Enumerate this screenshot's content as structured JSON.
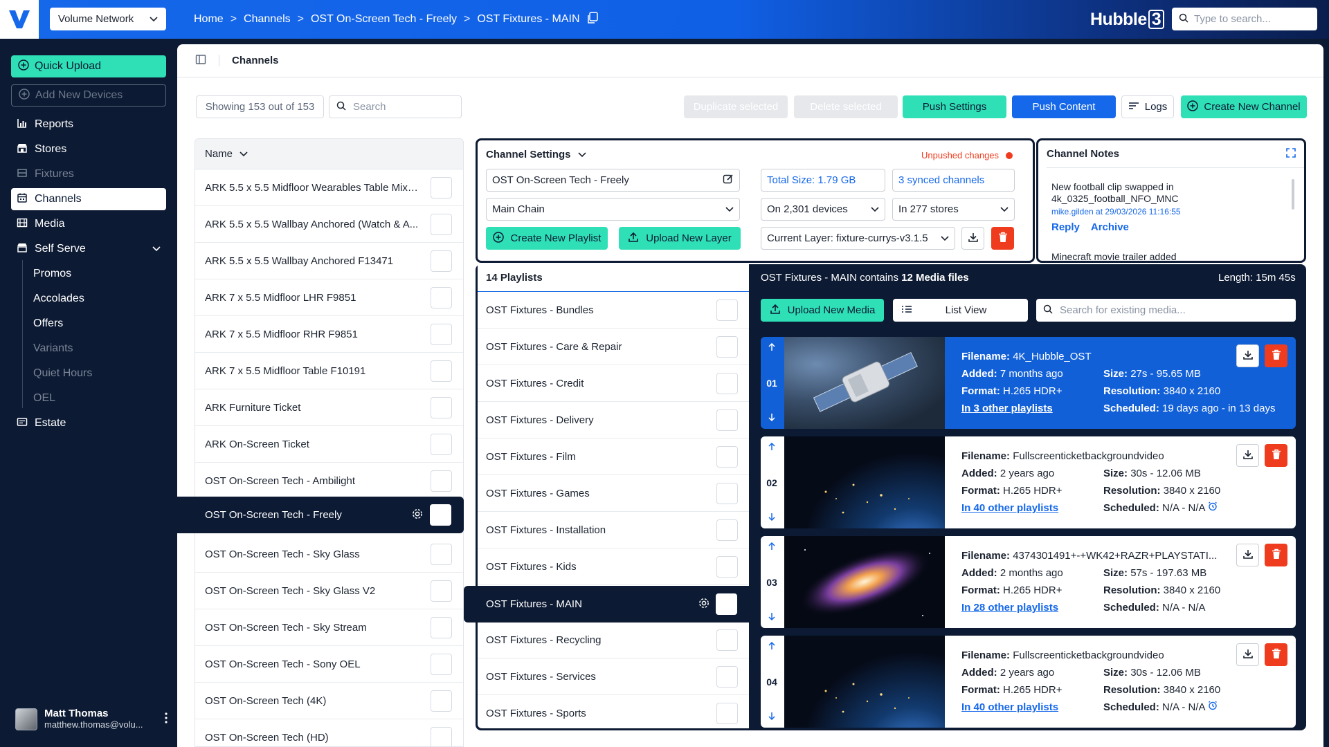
{
  "app": {
    "network": "Volume Network",
    "brand": "Hubble",
    "brand_badge": "3",
    "search_placeholder": "Type to search..."
  },
  "breadcrumb": [
    "Home",
    "Channels",
    "OST On-Screen Tech - Freely",
    "OST Fixtures - MAIN"
  ],
  "sidebar": {
    "quick_upload": "Quick Upload",
    "add_devices": "Add New Devices",
    "items": [
      {
        "label": "Reports",
        "icon": "bar-chart-icon"
      },
      {
        "label": "Stores",
        "icon": "store-icon"
      },
      {
        "label": "Fixtures",
        "icon": "fixture-icon"
      },
      {
        "label": "Channels",
        "icon": "calendar-icon"
      },
      {
        "label": "Media",
        "icon": "film-icon"
      },
      {
        "label": "Self Serve",
        "icon": "store-icon"
      }
    ],
    "sub_items": [
      "Promos",
      "Accolades",
      "Offers",
      "Variants",
      "Quiet Hours",
      "OEL"
    ],
    "estate": "Estate",
    "user": {
      "name": "Matt Thomas",
      "email": "matthew.thomas@volu..."
    }
  },
  "page": {
    "title": "Channels"
  },
  "toolbar": {
    "showing": "Showing 153 out of 153",
    "search_placeholder": "Search",
    "duplicate": "Duplicate selected",
    "delete": "Delete selected",
    "push_settings": "Push Settings",
    "push_content": "Push Content",
    "logs": "Logs",
    "create_channel": "Create New Channel"
  },
  "channels": {
    "header": "Name",
    "rows": [
      "ARK 5.5 x 5.5 Midfloor Wearables Table Mixe...",
      "ARK 5.5 x 5.5 Wallbay Anchored (Watch & A...",
      "ARK 5.5 x 5.5 Wallbay Anchored F13471",
      "ARK 7 x 5.5 Midfloor LHR F9851",
      "ARK 7 x 5.5 Midfloor RHR F9851",
      "ARK 7 x 5.5 Midfloor Table F10191",
      "ARK Furniture Ticket",
      "ARK On-Screen Ticket",
      "OST On-Screen Tech - Ambilight",
      "OST On-Screen Tech - Freely",
      "OST On-Screen Tech - Sky Glass",
      "OST On-Screen Tech - Sky Glass V2",
      "OST On-Screen Tech - Sky Stream",
      "OST On-Screen Tech - Sony OEL",
      "OST On-Screen Tech (4K)",
      "OST On-Screen Tech (HD)"
    ]
  },
  "settings": {
    "title": "Channel Settings",
    "unpushed": "Unpushed changes",
    "name": "OST On-Screen Tech - Freely",
    "chain": "Main Chain",
    "total_size": "Total Size: 1.79 GB",
    "synced": "3 synced channels",
    "devices": "On 2,301 devices",
    "stores": "In 277 stores",
    "create_playlist": "Create New Playlist",
    "upload_layer": "Upload New Layer",
    "current_layer": "Current Layer: fixture-currys-v3.1.5"
  },
  "notes": {
    "title": "Channel Notes",
    "note1": "New football clip swapped in 4k_0325_football_NFO_MNC",
    "meta1": "mike.gilden at 29/03/2026 11:16:55",
    "reply": "Reply",
    "archive": "Archive",
    "note2": "Minecraft movie trailer added"
  },
  "playlists": {
    "header": "14 Playlists",
    "rows": [
      "OST Fixtures - Bundles",
      "OST Fixtures - Care & Repair",
      "OST Fixtures - Credit",
      "OST Fixtures - Delivery",
      "OST Fixtures - Film",
      "OST Fixtures - Games",
      "OST Fixtures - Installation",
      "OST Fixtures - Kids",
      "OST Fixtures - MAIN",
      "OST Fixtures - Recycling",
      "OST Fixtures - Services",
      "OST Fixtures - Sports"
    ]
  },
  "media_panel": {
    "contains_prefix": "OST Fixtures - MAIN contains ",
    "contains_count": "12 Media files",
    "length": "Length: 15m 45s",
    "upload": "Upload New Media",
    "list_view": "List View",
    "search_placeholder": "Search for existing media...",
    "labels": {
      "filename": "Filename:",
      "added": "Added:",
      "format": "Format:",
      "size": "Size:",
      "resolution": "Resolution:",
      "scheduled": "Scheduled:"
    },
    "items": [
      {
        "num": "01",
        "filename": "4K_Hubble_OST",
        "added": "7 months ago",
        "format": "H.265 HDR+",
        "playlists": "In 3 other playlists",
        "size": "27s - 95.65 MB",
        "resolution": "3840 x 2160",
        "scheduled": "19 days ago - in 13 days"
      },
      {
        "num": "02",
        "filename": "Fullscreenticketbackgroundvideo",
        "added": "2 years ago",
        "format": "H.265 HDR+",
        "playlists": "In 40 other playlists",
        "size": "30s - 12.06 MB",
        "resolution": "3840 x 2160",
        "scheduled": "N/A - N/A"
      },
      {
        "num": "03",
        "filename": "4374301491+-+WK42+RAZR+PLAYSTATI...",
        "added": "2 months ago",
        "format": "H.265 HDR+",
        "playlists": "In 28 other playlists",
        "size": "57s - 197.63 MB",
        "resolution": "3840 x 2160",
        "scheduled": "N/A - N/A"
      },
      {
        "num": "04",
        "filename": "Fullscreenticketbackgroundvideo",
        "added": "2 years ago",
        "format": "H.265 HDR+",
        "playlists": "In 40 other playlists",
        "size": "30s - 12.06 MB",
        "resolution": "3840 x 2160",
        "scheduled": "N/A - N/A"
      }
    ]
  },
  "colors": {
    "accent_teal": "#2fe0b7",
    "brand_blue": "#1668ea",
    "navy": "#0c1a33",
    "danger": "#f03c1e"
  }
}
